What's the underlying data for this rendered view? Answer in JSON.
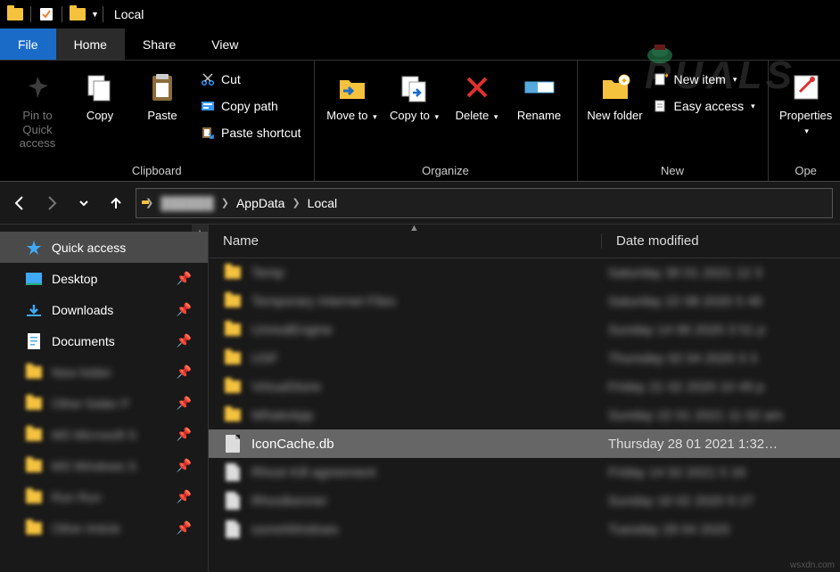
{
  "window": {
    "title": "Local"
  },
  "tabs": {
    "file": "File",
    "home": "Home",
    "share": "Share",
    "view": "View"
  },
  "ribbon": {
    "clipboard": {
      "label": "Clipboard",
      "pin": "Pin to Quick access",
      "copy": "Copy",
      "paste": "Paste",
      "cut": "Cut",
      "copy_path": "Copy path",
      "paste_shortcut": "Paste shortcut"
    },
    "organize": {
      "label": "Organize",
      "move_to": "Move to",
      "copy_to": "Copy to",
      "delete": "Delete",
      "rename": "Rename"
    },
    "new": {
      "label": "New",
      "new_folder": "New folder",
      "new_item": "New item",
      "easy_access": "Easy access"
    },
    "open": {
      "label": "Ope",
      "properties": "Properties"
    }
  },
  "breadcrumbs": {
    "user_hidden": "██████",
    "appdata": "AppData",
    "local": "Local"
  },
  "sidebar": {
    "quick_access": "Quick access",
    "desktop": "Desktop",
    "downloads": "Downloads",
    "documents": "Documents"
  },
  "columns": {
    "name": "Name",
    "date": "Date modified"
  },
  "selected_file": {
    "name": "IconCache.db",
    "date": "Thursday 28 01 2021 1:32…"
  },
  "watermark": "PUALS",
  "source_tag": "wsxdn.com"
}
